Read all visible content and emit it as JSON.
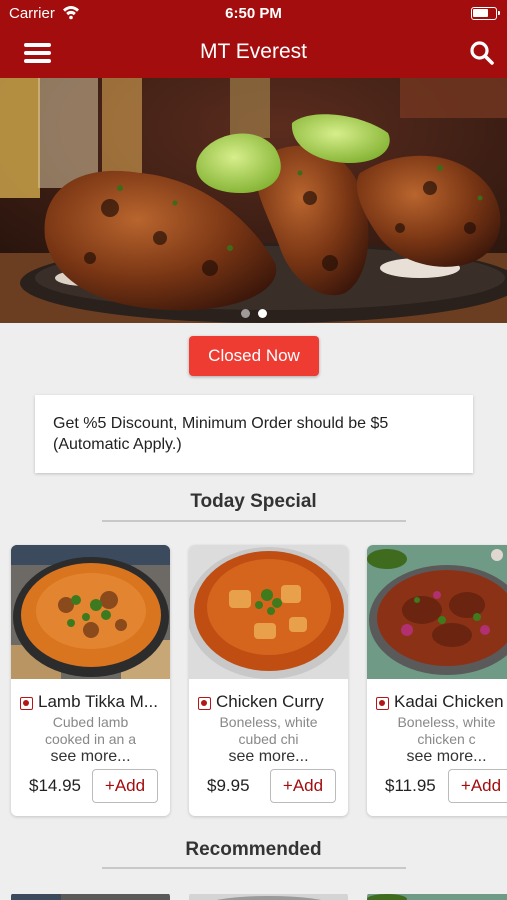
{
  "status_bar": {
    "carrier": "Carrier",
    "time": "6:50 PM"
  },
  "nav": {
    "title": "MT Everest"
  },
  "hero": {
    "slides": 2,
    "active_slide": 2
  },
  "status_button": {
    "label": "Closed Now"
  },
  "discount": {
    "text": "Get %5 Discount, Minimum  Order should be $5 (Automatic Apply.)"
  },
  "sections": {
    "today_special": "Today Special",
    "recommended": "Recommended"
  },
  "today_special": [
    {
      "name": "Lamb Tikka M...",
      "description": "Cubed lamb cooked in an a",
      "see_more": "see more...",
      "price": "$14.95",
      "add_label": "+Add"
    },
    {
      "name": "Chicken Curry",
      "description": "Boneless, white cubed chi",
      "see_more": "see more...",
      "price": "$9.95",
      "add_label": "+Add"
    },
    {
      "name": "Kadai Chicken",
      "description": "Boneless, white chicken c",
      "see_more": "see more...",
      "price": "$11.95",
      "add_label": "+Add"
    }
  ],
  "colors": {
    "brand": "#a30d0d",
    "closed_button": "#ee3c33",
    "background": "#eeeeee"
  },
  "icons": {
    "menu": "hamburger-menu-icon",
    "search": "search-icon",
    "veg": "non-veg-indicator-icon"
  }
}
